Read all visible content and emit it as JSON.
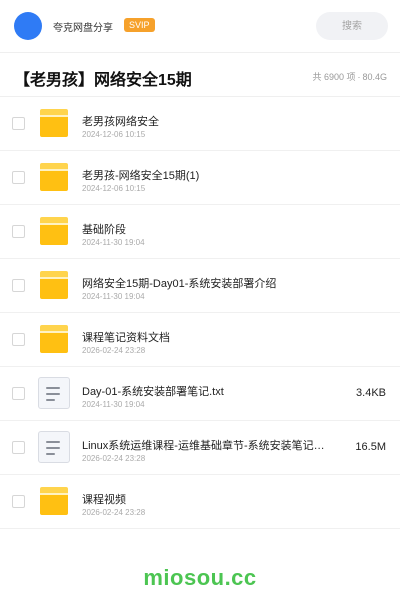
{
  "header": {
    "brand": "夸克网盘分享",
    "badge": "SVIP",
    "search_placeholder": "搜索"
  },
  "share": {
    "title": "【老男孩】网络安全15期",
    "count": "共 6900 项",
    "total_size": "80.4G"
  },
  "files": [
    {
      "type": "folder",
      "name": "老男孩网络安全",
      "date": "2024-12-06 10:15",
      "size": ""
    },
    {
      "type": "folder",
      "name": "老男孩-网络安全15期(1)",
      "date": "2024-12-06 10:15",
      "size": ""
    },
    {
      "type": "folder",
      "name": "基础阶段",
      "date": "2024-11-30 19:04",
      "size": ""
    },
    {
      "type": "folder",
      "name": "网络安全15期-Day01-系统安装部署介绍",
      "date": "2024-11-30 19:04",
      "size": ""
    },
    {
      "type": "folder",
      "name": "课程笔记资料文档",
      "date": "2026-02-24 23:28",
      "size": ""
    },
    {
      "type": "doc",
      "name": "Day-01-系统安装部署笔记.txt",
      "date": "2024-11-30 19:04",
      "size": "3.4KB"
    },
    {
      "type": "doc",
      "name": "Linux系统运维课程-运维基础章节-系统安装笔记…",
      "date": "2026-02-24 23:28",
      "size": "16.5M"
    },
    {
      "type": "folder",
      "name": "课程视频",
      "date": "2026-02-24 23:28",
      "size": ""
    }
  ],
  "watermark": "miosou.cc",
  "colors": {
    "accent": "#2f7bf5",
    "svip": "#f6a12b",
    "folder": "#ffc012",
    "watermark": "#4cc552"
  },
  "icons": {
    "folder": "folder-icon",
    "doc": "text-file-icon"
  }
}
